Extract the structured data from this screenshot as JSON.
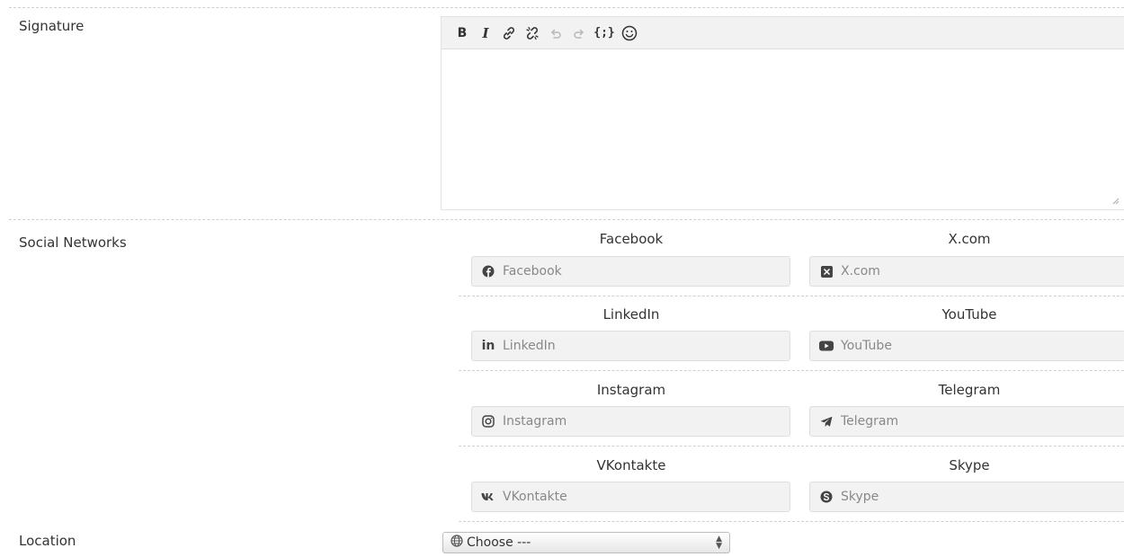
{
  "signature": {
    "label": "Signature",
    "toolbar": [
      {
        "name": "bold-button",
        "icon": "bold-icon",
        "glyph": "B"
      },
      {
        "name": "italic-button",
        "icon": "italic-icon",
        "glyph": "I"
      },
      {
        "name": "link-button",
        "icon": "link-icon"
      },
      {
        "name": "unlink-button",
        "icon": "unlink-icon"
      },
      {
        "name": "undo-button",
        "icon": "undo-icon"
      },
      {
        "name": "redo-button",
        "icon": "redo-icon"
      },
      {
        "name": "code-button",
        "icon": "code-icon",
        "glyph": "{;}"
      },
      {
        "name": "emoji-button",
        "icon": "emoji-icon"
      }
    ],
    "content": ""
  },
  "social": {
    "label": "Social Networks",
    "networks": [
      {
        "title": "Facebook",
        "placeholder": "Facebook",
        "icon": "facebook-icon"
      },
      {
        "title": "X.com",
        "placeholder": "X.com",
        "icon": "x-icon"
      },
      {
        "title": "LinkedIn",
        "placeholder": "LinkedIn",
        "icon": "linkedin-icon"
      },
      {
        "title": "YouTube",
        "placeholder": "YouTube",
        "icon": "youtube-icon"
      },
      {
        "title": "Instagram",
        "placeholder": "Instagram",
        "icon": "instagram-icon"
      },
      {
        "title": "Telegram",
        "placeholder": "Telegram",
        "icon": "telegram-icon"
      },
      {
        "title": "VKontakte",
        "placeholder": "VKontakte",
        "icon": "vk-icon"
      },
      {
        "title": "Skype",
        "placeholder": "Skype",
        "icon": "skype-icon"
      }
    ]
  },
  "location": {
    "label": "Location",
    "selected": "Choose ---",
    "icon": "globe-icon"
  },
  "colors": {
    "input_bg": "#f2f2f2",
    "toolbar_bg": "#f2f2f2",
    "border": "#dedede",
    "text": "#333333",
    "placeholder": "#888888"
  }
}
